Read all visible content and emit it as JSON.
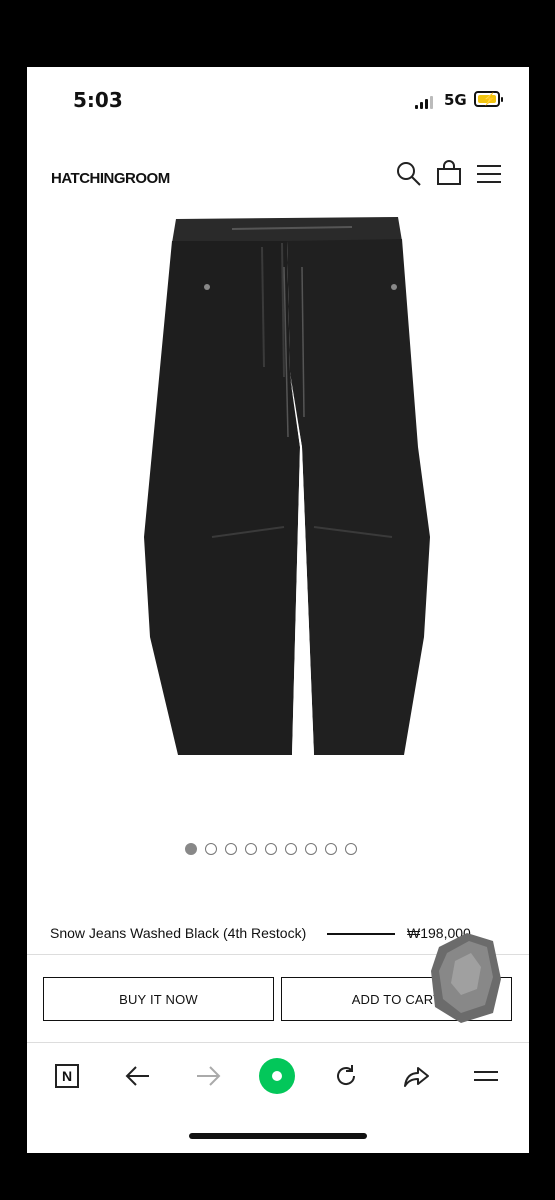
{
  "status_bar": {
    "time": "5:03",
    "network": "5G"
  },
  "header": {
    "logo": "HATCHINGROOM"
  },
  "carousel": {
    "total": 9,
    "active_index": 0
  },
  "product": {
    "name": "Snow Jeans Washed Black (4th Restock)",
    "price": "₩198,000"
  },
  "actions": {
    "buy_now": "BUY IT NOW",
    "add_to_cart": "ADD TO CART"
  },
  "browser_toolbar": {
    "naver_label": "N"
  },
  "colors": {
    "accent_green": "#03c75a",
    "text": "#111111",
    "battery": "#f1c40f"
  }
}
